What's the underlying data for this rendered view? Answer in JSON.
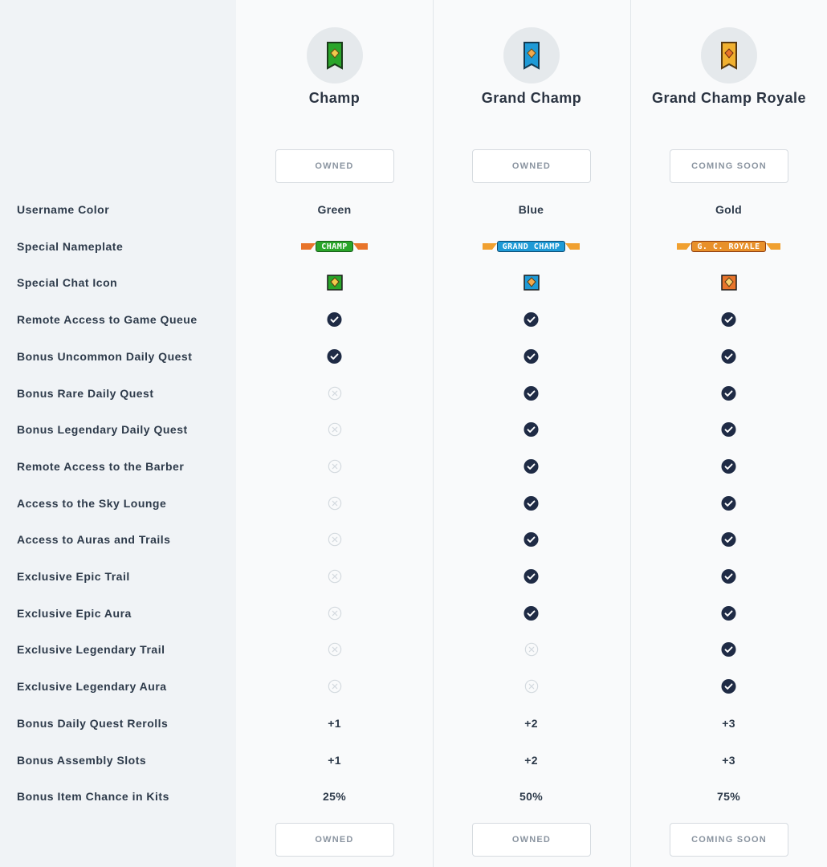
{
  "tiers": [
    {
      "name": "Champ",
      "status_top": "OWNED",
      "status_bottom": "OWNED",
      "color": "#2aa52a"
    },
    {
      "name": "Grand Champ",
      "status_top": "OWNED",
      "status_bottom": "OWNED",
      "color": "#1e9ad6"
    },
    {
      "name": "Grand Champ Royale",
      "status_top": "COMING SOON",
      "status_bottom": "COMING SOON",
      "color": "#e8902a"
    }
  ],
  "rows": [
    {
      "label": "Username Color",
      "values": [
        "Green",
        "Blue",
        "Gold"
      ],
      "type": "text"
    },
    {
      "label": "Special Nameplate",
      "values": [
        "CHAMP",
        "GRAND CHAMP",
        "G. C. ROYALE"
      ],
      "type": "nameplate"
    },
    {
      "label": "Special Chat Icon",
      "values": [
        "chat-icon-champ",
        "chat-icon-grand-champ",
        "chat-icon-royale"
      ],
      "type": "icon"
    },
    {
      "label": "Remote Access to Game Queue",
      "values": [
        true,
        true,
        true
      ],
      "type": "bool"
    },
    {
      "label": "Bonus Uncommon Daily Quest",
      "values": [
        true,
        true,
        true
      ],
      "type": "bool"
    },
    {
      "label": "Bonus Rare Daily Quest",
      "values": [
        false,
        true,
        true
      ],
      "type": "bool"
    },
    {
      "label": "Bonus Legendary Daily Quest",
      "values": [
        false,
        true,
        true
      ],
      "type": "bool"
    },
    {
      "label": "Remote Access to the Barber",
      "values": [
        false,
        true,
        true
      ],
      "type": "bool"
    },
    {
      "label": "Access to the Sky Lounge",
      "values": [
        false,
        true,
        true
      ],
      "type": "bool"
    },
    {
      "label": "Access to Auras and Trails",
      "values": [
        false,
        true,
        true
      ],
      "type": "bool"
    },
    {
      "label": "Exclusive Epic Trail",
      "values": [
        false,
        true,
        true
      ],
      "type": "bool"
    },
    {
      "label": "Exclusive Epic Aura",
      "values": [
        false,
        true,
        true
      ],
      "type": "bool"
    },
    {
      "label": "Exclusive Legendary Trail",
      "values": [
        false,
        false,
        true
      ],
      "type": "bool"
    },
    {
      "label": "Exclusive Legendary Aura",
      "values": [
        false,
        false,
        true
      ],
      "type": "bool"
    },
    {
      "label": "Bonus Daily Quest Rerolls",
      "values": [
        "+1",
        "+2",
        "+3"
      ],
      "type": "text"
    },
    {
      "label": "Bonus Assembly Slots",
      "values": [
        "+1",
        "+2",
        "+3"
      ],
      "type": "text"
    },
    {
      "label": "Bonus Item Chance in Kits",
      "values": [
        "25%",
        "50%",
        "75%"
      ],
      "type": "text"
    }
  ],
  "icons": {
    "included": "check-circle-icon",
    "excluded": "x-circle-icon"
  },
  "colors": {
    "check": "#1f2b45",
    "cross": "#d4dadf",
    "label_bg": "#f0f3f6",
    "column_bg": "#f9fafb"
  }
}
